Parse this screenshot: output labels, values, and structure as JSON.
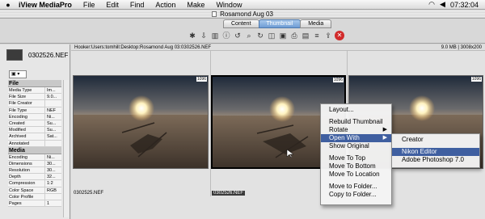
{
  "menubar": {
    "app": "iView MediaPro",
    "items": [
      "File",
      "Edit",
      "Find",
      "Action",
      "Make",
      "Window"
    ],
    "time": "07:32:04"
  },
  "window": {
    "title": "Rosamond Aug 03"
  },
  "tabs": [
    {
      "label": "Content"
    },
    {
      "label": "Thumbnail"
    },
    {
      "label": "Media"
    }
  ],
  "sidebar": {
    "filename": "0302526.NEF",
    "sections": [
      {
        "label": "File",
        "rows": [
          {
            "key": "Media Type",
            "value": "Im..."
          },
          {
            "key": "File Size",
            "value": "9.0..."
          },
          {
            "key": "File Creator",
            "value": ""
          },
          {
            "key": "File Type",
            "value": "NEF"
          },
          {
            "key": "Encoding",
            "value": "Ni..."
          },
          {
            "key": "Created",
            "value": "Su..."
          },
          {
            "key": "Modified",
            "value": "Su..."
          },
          {
            "key": "Archived",
            "value": "Sat..."
          },
          {
            "key": "Annotated",
            "value": ""
          }
        ]
      },
      {
        "label": "Media",
        "rows": [
          {
            "key": "Encoding",
            "value": "Ni..."
          },
          {
            "key": "Dimensions",
            "value": "30..."
          },
          {
            "key": "Resolution",
            "value": "30..."
          },
          {
            "key": "Depth",
            "value": "32..."
          },
          {
            "key": "Compression",
            "value": "1:2"
          },
          {
            "key": "Color Space",
            "value": "RGB"
          },
          {
            "key": "Color Profile",
            "value": ""
          },
          {
            "key": "Pages",
            "value": "1"
          }
        ]
      }
    ]
  },
  "pathbar": {
    "path": "Hooker:Users:tomhill:Desktop:Rosamond Aug 03:0302526.NEF",
    "size": "9.0 MB | 3008x200"
  },
  "thumbnails": [
    {
      "badge": "1096",
      "caption": "0302525.NEF"
    },
    {
      "badge": "1096",
      "caption": "0302526.NEF"
    },
    {
      "badge": "1096",
      "caption": ""
    }
  ],
  "context_menu": {
    "items": [
      {
        "label": "Layout..."
      },
      {
        "label": "Rebuild Thumbnail"
      },
      {
        "label": "Rotate"
      },
      {
        "label": "Open With"
      },
      {
        "label": "Show Original"
      },
      {
        "label": "Move To Top"
      },
      {
        "label": "Move To Bottom"
      },
      {
        "label": "Move To Location"
      },
      {
        "label": "Move to Folder..."
      },
      {
        "label": "Copy to Folder..."
      }
    ],
    "submenu": [
      {
        "label": "Creator"
      },
      {
        "label": "Nikon Editor"
      },
      {
        "label": "Adobe Photoshop 7.0"
      }
    ]
  },
  "colors": {
    "highlight": "#3f5fa0",
    "active_tab": "#6d9cd4"
  }
}
